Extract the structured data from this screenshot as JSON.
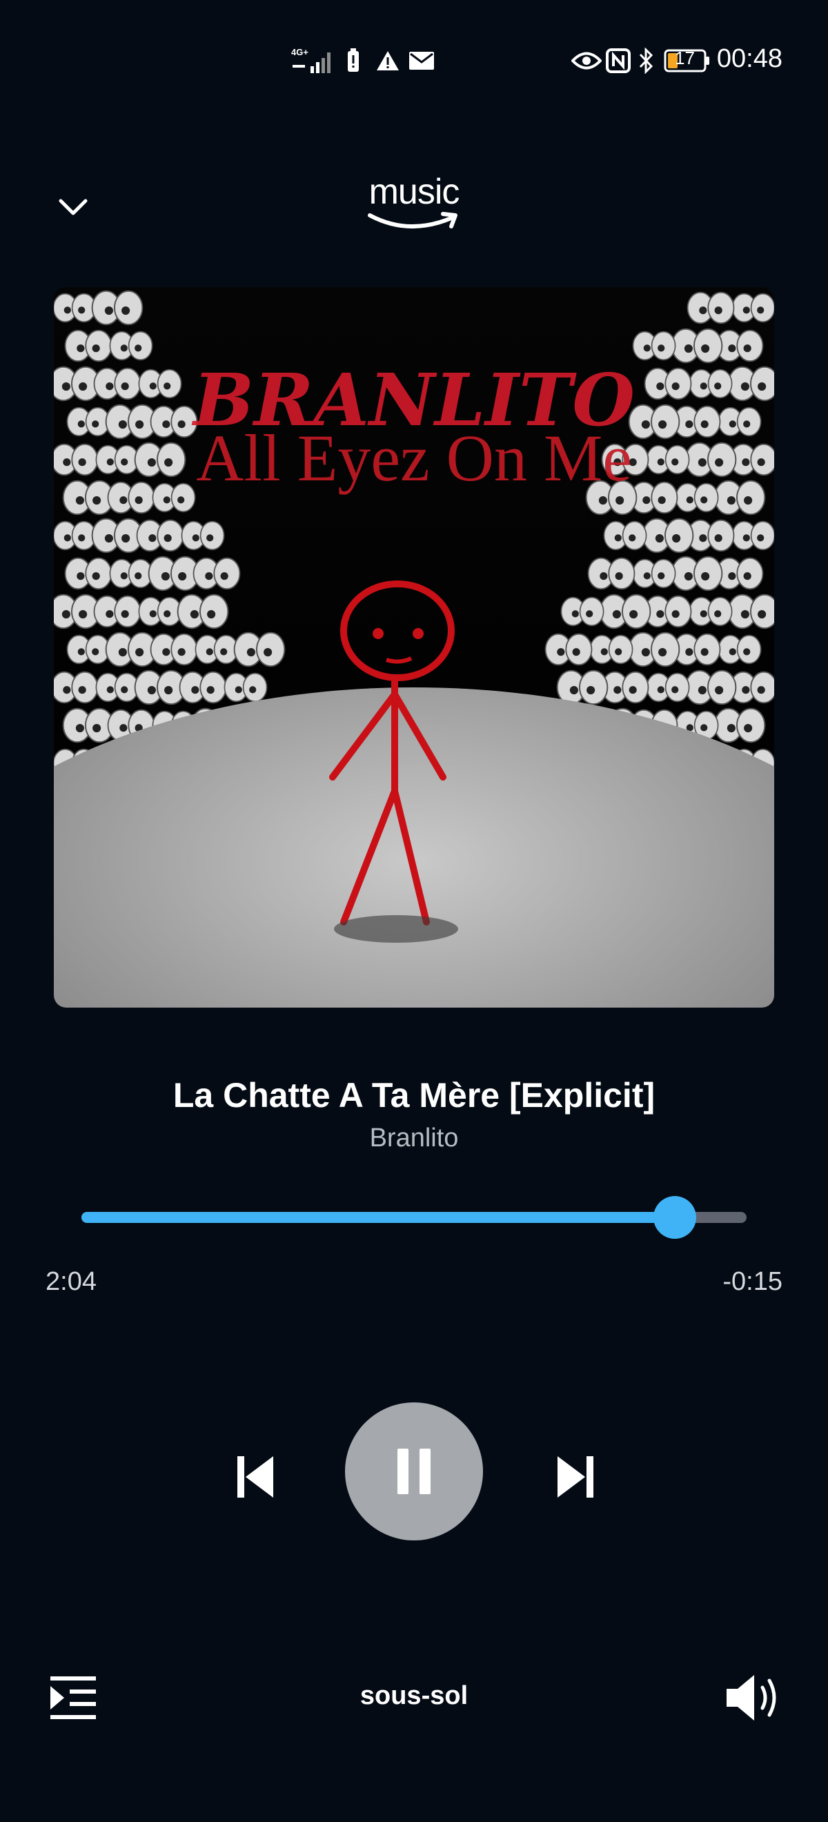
{
  "status_bar": {
    "network": "4G+",
    "battery_level": "17",
    "time": "00:48"
  },
  "header": {
    "logo_text": "music"
  },
  "artwork": {
    "artist_text": "BRANLITO",
    "album_text": "All Eyez On Me"
  },
  "track": {
    "title": "La Chatte A Ta Mère [Explicit]",
    "artist": "Branlito"
  },
  "progress": {
    "elapsed": "2:04",
    "remaining": "-0:15",
    "fraction": 0.892
  },
  "output": {
    "device": "sous-sol"
  },
  "colors": {
    "background": "#040b14",
    "accent": "#3fb3f5",
    "play_button": "#a5a9ae",
    "track_bg": "#5f6470"
  },
  "icons": {
    "collapse": "chevron-down-icon",
    "previous": "skip-previous-icon",
    "pause": "pause-icon",
    "next": "skip-next-icon",
    "queue": "queue-icon",
    "volume": "volume-icon"
  }
}
